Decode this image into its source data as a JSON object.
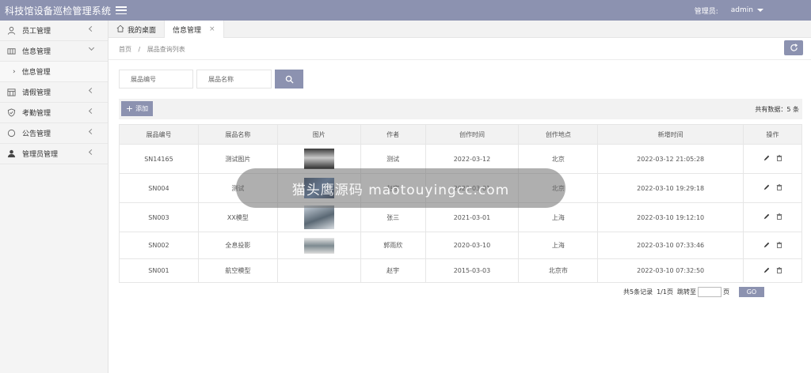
{
  "app": {
    "title": "科技馆设备巡检管理系统"
  },
  "user": {
    "label": "管理员:",
    "name": "admin"
  },
  "sidebar": {
    "items": [
      {
        "label": "员工管理",
        "icon": "user-icon"
      },
      {
        "label": "信息管理",
        "icon": "grid-icon"
      },
      {
        "label": "信息管理",
        "icon": "chevron-right-icon",
        "sub": true
      },
      {
        "label": "请假管理",
        "icon": "calendar-icon"
      },
      {
        "label": "考勤管理",
        "icon": "shield-icon"
      },
      {
        "label": "公告管理",
        "icon": "circle-icon"
      },
      {
        "label": "管理员管理",
        "icon": "person-icon"
      }
    ]
  },
  "tabs": [
    {
      "label": "我的桌面"
    },
    {
      "label": "信息管理",
      "close": "×"
    }
  ],
  "breadcrumb": {
    "home": "首页",
    "sep": "/",
    "current": "展品查询列表"
  },
  "search": {
    "code_placeholder": "展品编号",
    "name_placeholder": "展品名称"
  },
  "toolbar": {
    "add_label": "添加",
    "total": "共有数据：5 条"
  },
  "table": {
    "headers": [
      "展品编号",
      "展品名称",
      "图片",
      "作者",
      "创作时间",
      "创作地点",
      "新增时间",
      "操作"
    ],
    "rows": [
      {
        "code": "SN14165",
        "name": "测试图片",
        "author": "测试",
        "created": "2022-03-12",
        "place": "北京",
        "added": "2022-03-12 21:05:28"
      },
      {
        "code": "SN004",
        "name": "测试",
        "author": "赵宇",
        "created": "2022-03-01",
        "place": "北京",
        "added": "2022-03-10 19:29:18"
      },
      {
        "code": "SN003",
        "name": "XX模型",
        "author": "张三",
        "created": "2021-03-01",
        "place": "上海",
        "added": "2022-03-10 19:12:10"
      },
      {
        "code": "SN002",
        "name": "全息投影",
        "author": "郭雨欣",
        "created": "2020-03-10",
        "place": "上海",
        "added": "2022-03-10 07:33:46"
      },
      {
        "code": "SN001",
        "name": "航空模型",
        "author": "赵宇",
        "created": "2015-03-03",
        "place": "北京市",
        "added": "2022-03-10 07:32:50"
      }
    ]
  },
  "pager": {
    "records": "共5条记录",
    "pages": "1/1页",
    "jump": "跳转至",
    "unit": "页",
    "go": "GO"
  },
  "watermark": {
    "text": "猫头鹰源码 maotouyingcc.com"
  },
  "colors": {
    "primary": "#8c92b0",
    "sidebar_bg": "#f4f4f4",
    "header_bg": "#f2f2f2"
  }
}
